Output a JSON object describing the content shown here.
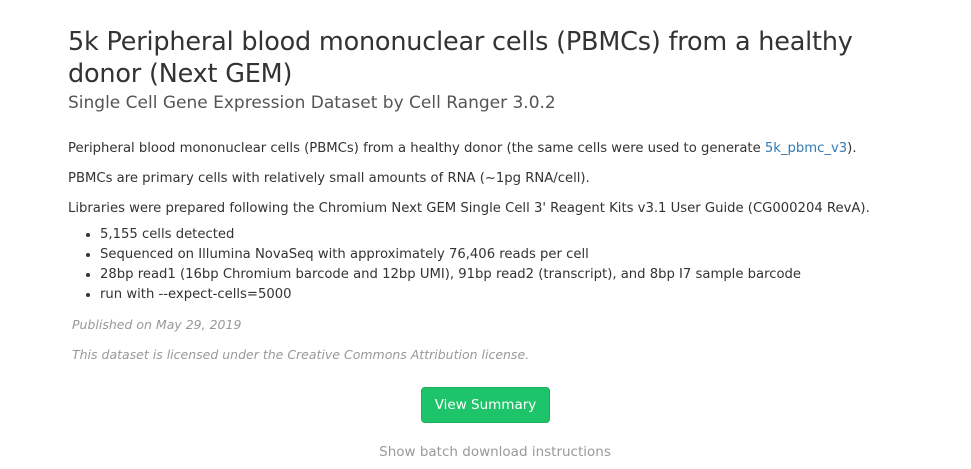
{
  "dataset": {
    "title": "5k Peripheral blood mononuclear cells (PBMCs) from a healthy donor (Next GEM)",
    "subtitle": "Single Cell Gene Expression Dataset by Cell Ranger 3.0.2"
  },
  "description": {
    "p1_prefix": "Peripheral blood mononuclear cells (PBMCs) from a healthy donor (the same cells were used to generate ",
    "p1_link": "5k_pbmc_v3",
    "p1_suffix": ").",
    "p2": "PBMCs are primary cells with relatively small amounts of RNA (~1pg RNA/cell).",
    "p3": "Libraries were prepared following the Chromium Next GEM Single Cell 3' Reagent Kits v3.1 User Guide (CG000204 RevA).",
    "facts": [
      "5,155 cells detected",
      "Sequenced on Illumina NovaSeq with approximately 76,406 reads per cell",
      "28bp read1 (16bp Chromium barcode and 12bp UMI), 91bp read2 (transcript), and 8bp I7 sample barcode",
      "run with --expect-cells=5000"
    ]
  },
  "meta": {
    "published": "Published on May 29, 2019",
    "license": "This dataset is licensed under the Creative Commons Attribution license."
  },
  "actions": {
    "view_summary_label": "View Summary",
    "batch_download_label": "Show batch download instructions"
  },
  "colors": {
    "button_green": "#1ec469",
    "link_blue": "#337ab7",
    "muted_gray": "#999999"
  }
}
